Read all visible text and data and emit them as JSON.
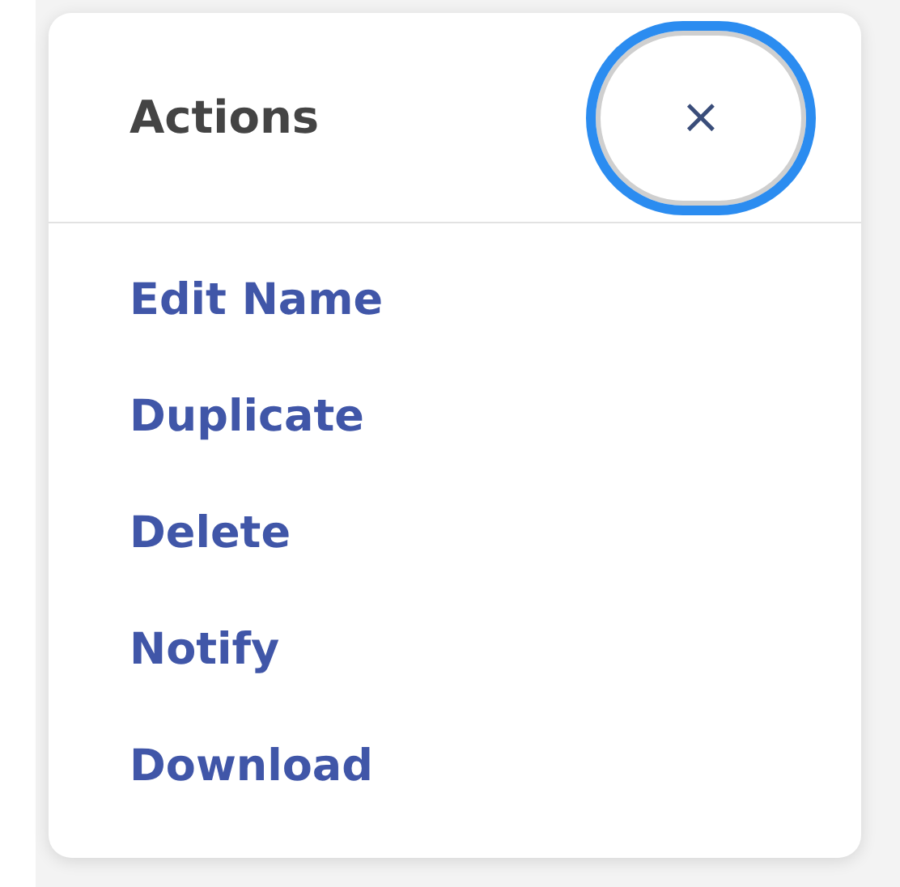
{
  "popover": {
    "title": "Actions",
    "close": {
      "label": "×",
      "focused": true
    },
    "items": [
      {
        "label": "Edit Name"
      },
      {
        "label": "Duplicate"
      },
      {
        "label": "Delete"
      },
      {
        "label": "Notify"
      },
      {
        "label": "Download"
      }
    ]
  }
}
